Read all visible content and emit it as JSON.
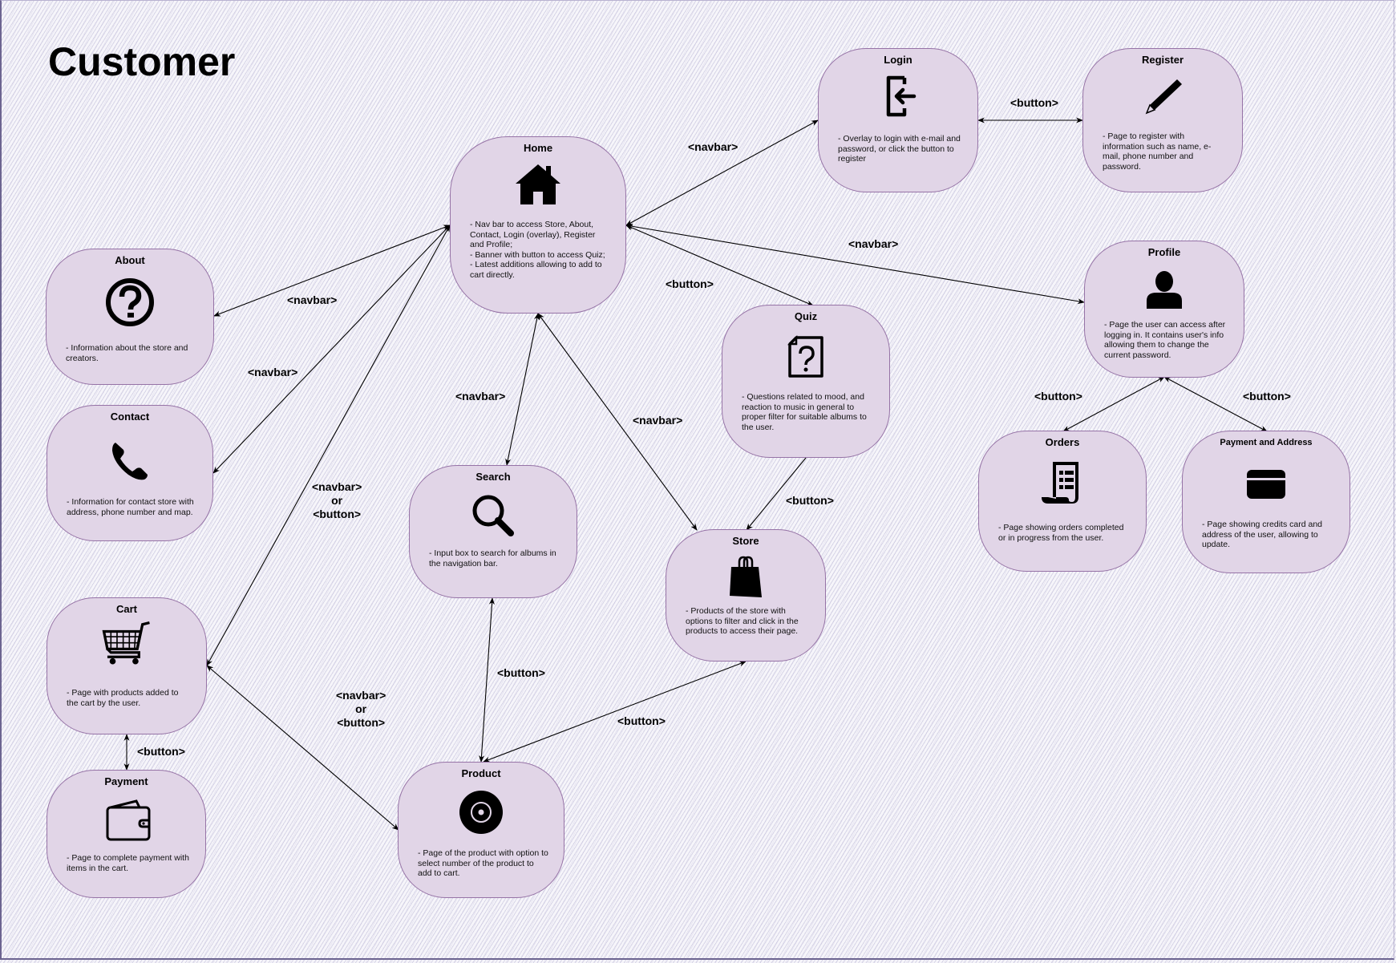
{
  "title": "Customer",
  "nodes": {
    "home": {
      "title": "Home",
      "icon": "house-icon",
      "desc": "- Nav bar to access Store, About, Contact, Login (overlay), Register and Profile;\n- Banner with button to access Quiz;\n- Latest additions allowing to add to cart directly."
    },
    "login": {
      "title": "Login",
      "icon": "login-icon",
      "desc": "- Overlay to login with e-mail and password, or click the button to register"
    },
    "register": {
      "title": "Register",
      "icon": "pencil-icon",
      "desc": "- Page to register with information such as name, e-mail, phone number and password."
    },
    "profile": {
      "title": "Profile",
      "icon": "user-icon",
      "desc": "- Page the user can access after logging in. It contains user's info allowing them to change the current password."
    },
    "quiz": {
      "title": "Quiz",
      "icon": "question-file-icon",
      "desc": "- Questions related to mood, and reaction to music in general to proper filter for suitable albums to the user."
    },
    "about": {
      "title": "About",
      "icon": "question-circle-icon",
      "desc": "- Information about the store and creators."
    },
    "contact": {
      "title": "Contact",
      "icon": "phone-icon",
      "desc": "- Information for contact store with address, phone number and map."
    },
    "search": {
      "title": "Search",
      "icon": "magnifier-icon",
      "desc": "- Input box to search for albums in the navigation bar."
    },
    "store": {
      "title": "Store",
      "icon": "shopping-bag-icon",
      "desc": "- Products of the store with options to filter and click in the products to access their page."
    },
    "orders": {
      "title": "Orders",
      "icon": "receipt-icon",
      "desc": "- Page showing orders completed or in progress from the user."
    },
    "payment_address": {
      "title": "Payment and Address",
      "icon": "credit-card-icon",
      "desc": "- Page showing credits card and address of the user, allowing to update."
    },
    "cart": {
      "title": "Cart",
      "icon": "cart-icon",
      "desc": "- Page with products added to the cart by the user."
    },
    "payment": {
      "title": "Payment",
      "icon": "wallet-icon",
      "desc": "- Page to complete payment with items in the cart."
    },
    "product": {
      "title": "Product",
      "icon": "disc-icon",
      "desc": "- Page of the product with option to select number of the product to add to cart."
    }
  },
  "edge_labels": {
    "home_login": "<navbar>",
    "login_register": "<button>",
    "home_profile": "<navbar>",
    "home_quiz": "<button>",
    "home_about": "<navbar>",
    "home_contact": "<navbar>",
    "home_search": "<navbar>",
    "home_store": "<navbar>",
    "home_cart": "<navbar>\nor\n<button>",
    "cart_product": "<navbar>\nor\n<button>",
    "quiz_store": "<button>",
    "search_product": "<button>",
    "store_product": "<button>",
    "cart_payment": "<button>",
    "profile_orders": "<button>",
    "profile_payment_address": "<button>"
  }
}
